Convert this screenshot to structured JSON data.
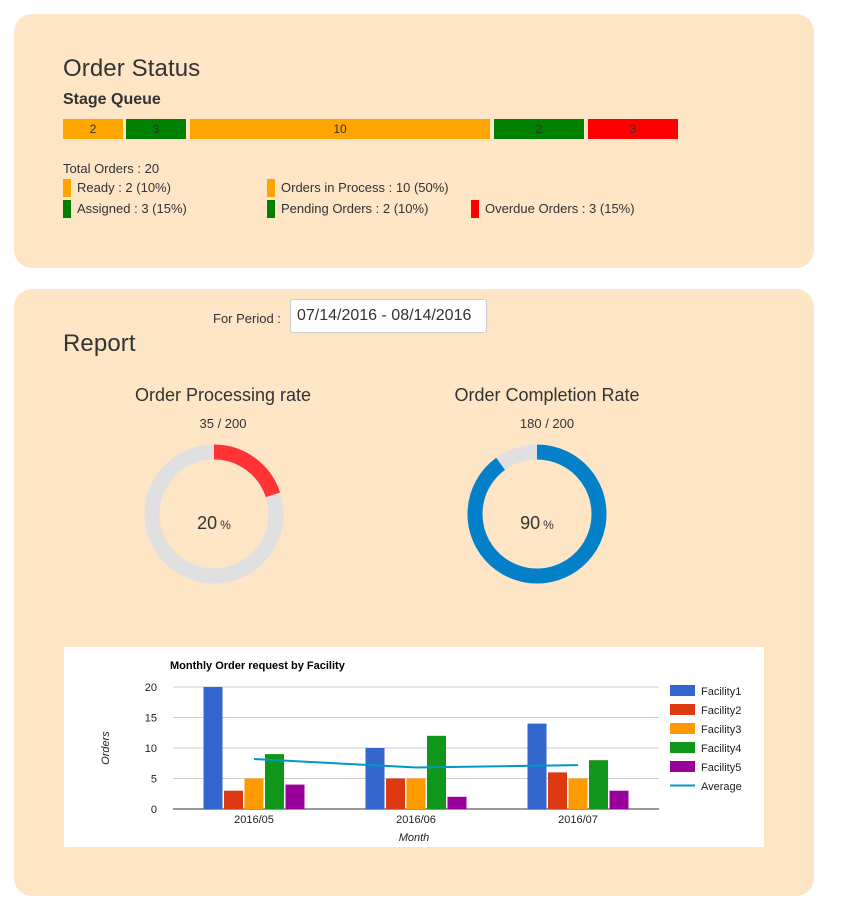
{
  "order_status": {
    "title": "Order Status",
    "stage_queue_label": "Stage Queue",
    "stage_segments": [
      {
        "value": "2",
        "color": "#ffa500"
      },
      {
        "value": "3",
        "color": "#008000"
      },
      {
        "value": "10",
        "color": "#ffa500"
      },
      {
        "value": "2",
        "color": "#008000"
      },
      {
        "value": "3",
        "color": "#ff0000"
      }
    ],
    "total_orders": "Total Orders : 20",
    "legend": {
      "ready": {
        "text": "Ready : 2 (10%)",
        "color": "#ffa500"
      },
      "assigned": {
        "text": "Assigned : 3 (15%)",
        "color": "#008000"
      },
      "in_process": {
        "text": "Orders in Process : 10 (50%)",
        "color": "#ffa500"
      },
      "pending": {
        "text": "Pending Orders : 2 (10%)",
        "color": "#008000"
      },
      "overdue": {
        "text": "Overdue Orders : 3 (15%)",
        "color": "#ff0000"
      }
    }
  },
  "report": {
    "title": "Report",
    "period_label": "For Period :",
    "period_value": "07/14/2016 - 08/14/2016",
    "gauges": [
      {
        "title": "Order Processing rate",
        "ratio": "35 / 200",
        "percent_value": "20",
        "percent_sign": "%",
        "fraction": 0.2,
        "color": "#ff3333",
        "track": "#e0e0e0"
      },
      {
        "title": "Order Completion Rate",
        "ratio": "180 / 200",
        "percent_value": "90",
        "percent_sign": "%",
        "fraction": 0.9,
        "color": "#0480c9",
        "track": "#e0e0e0"
      }
    ]
  },
  "chart_data": {
    "type": "bar",
    "title": "Monthly Order request by Facility",
    "xlabel": "Month",
    "ylabel": "Orders",
    "ylim": [
      0,
      20
    ],
    "yticks": [
      "0",
      "5",
      "10",
      "15",
      "20"
    ],
    "grid": true,
    "legend_position": "right",
    "categories": [
      "2016/05",
      "2016/06",
      "2016/07"
    ],
    "series": [
      {
        "name": "Facility1",
        "values": [
          20,
          10,
          14
        ],
        "color": "#3366cc"
      },
      {
        "name": "Facility2",
        "values": [
          3,
          5,
          6
        ],
        "color": "#dc3912"
      },
      {
        "name": "Facility3",
        "values": [
          5,
          5,
          5
        ],
        "color": "#ff9900"
      },
      {
        "name": "Facility4",
        "values": [
          9,
          12,
          8
        ],
        "color": "#109618"
      },
      {
        "name": "Facility5",
        "values": [
          4,
          2,
          3
        ],
        "color": "#990099"
      }
    ],
    "line_series": {
      "name": "Average",
      "values": [
        8.2,
        6.8,
        7.2
      ],
      "color": "#0099c6"
    }
  }
}
